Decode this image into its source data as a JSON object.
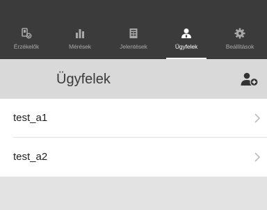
{
  "tabs": [
    {
      "label": "Érzékelők",
      "icon": "sensor-icon",
      "active": false
    },
    {
      "label": "Mérések",
      "icon": "bar-chart-icon",
      "active": false
    },
    {
      "label": "Jelentések",
      "icon": "report-icon",
      "active": false
    },
    {
      "label": "Ügyfelek",
      "icon": "user-icon",
      "active": true
    },
    {
      "label": "Beállítások",
      "icon": "gear-icon",
      "active": false
    }
  ],
  "header": {
    "title": "Ügyfelek",
    "add_icon": "add-user-icon"
  },
  "clients": [
    {
      "label": "test_a1"
    },
    {
      "label": "test_a2"
    }
  ],
  "colors": {
    "tabbar_bg": "#3b3b3b",
    "tab_inactive": "#a9a9a9",
    "tab_active": "#ffffff",
    "header_bg": "#d9d9d9",
    "page_bg": "#e3e3e3"
  }
}
